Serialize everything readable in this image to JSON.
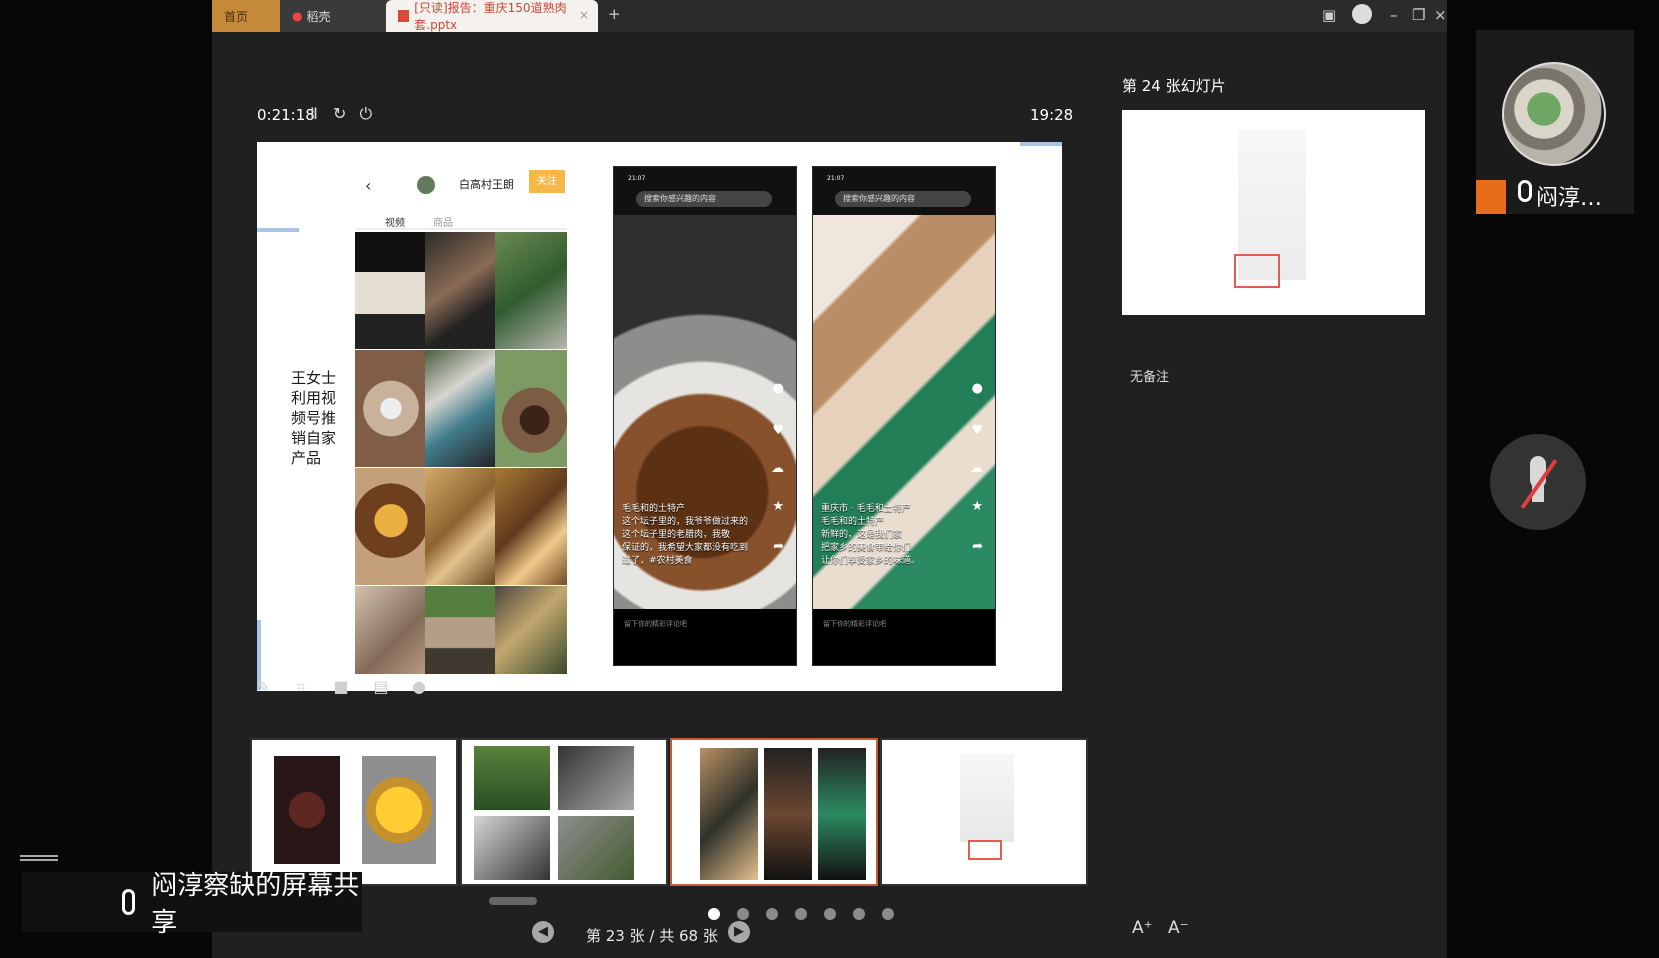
{
  "tabs": [
    {
      "label": "首页"
    },
    {
      "label": "稻壳"
    },
    {
      "label": "[只读]报告：重庆150道熟肉套.pptx"
    }
  ],
  "window": {
    "add_tab": "+",
    "minimize": "–",
    "restore": "❐",
    "close": "×"
  },
  "presenter": {
    "elapsed_time": "0:21:18",
    "clock": "19:28",
    "slide_caption": "王女士\n利用视\n频号推\n销自家\n产品",
    "profile_name": "白高村王朗",
    "follow_label": "关注",
    "tab_video": "视频",
    "tab_goods": "商品",
    "phone1": {
      "search": "搜索你感兴趣的内容",
      "caption": "毛毛和的土特产\n这个坛子里的，我爷爷做过来的\n这个坛子里的老腊肉，我敬\n保证的，我希望大家都没有吃到\n过了，#农村美食",
      "comment": "留下你的精彩评论吧",
      "top": "21:07"
    },
    "phone2": {
      "search": "搜索你感兴趣的内容",
      "caption": "重庆市 · 毛毛和土特产\n毛毛和的土特产\n新鲜的，这是我们家\n把家乡的美食带给你们\n让你们享受家乡的味道。",
      "comment": "留下你的精彩评论吧",
      "top": "21:07"
    },
    "slide_counter": "第 23 张 / 共 68 张",
    "current_page": 23,
    "total_pages": 68
  },
  "right_panel": {
    "slide_number": "第 24 张幻灯片",
    "notes": "无备注",
    "font_increase": "A⁺",
    "font_decrease": "A⁻"
  },
  "camera": {
    "user": "闷淳…"
  },
  "share": {
    "label": "闷淳察缺的屏幕共享"
  }
}
